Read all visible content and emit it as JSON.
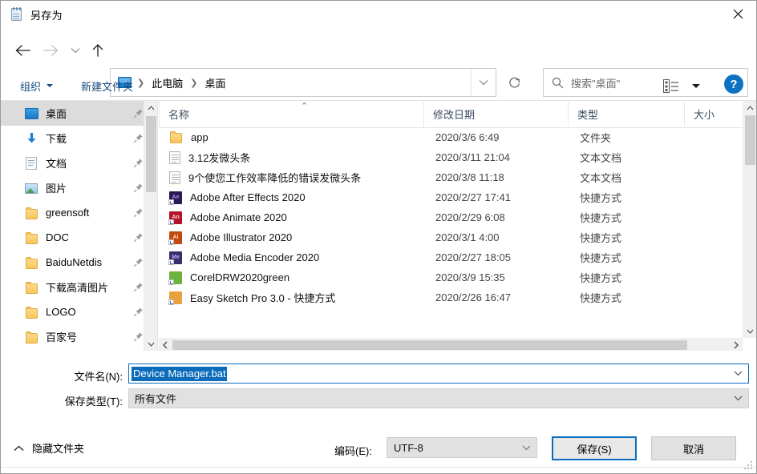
{
  "window": {
    "title": "另存为",
    "title_icon": "notepad-icon",
    "close_label": "✕"
  },
  "nav": {
    "back": "←",
    "forward": "→",
    "recent": "⌄",
    "up": "↑",
    "refresh": "↻",
    "breadcrumb": {
      "icon": "this-pc-icon",
      "items": [
        "此电脑",
        "桌面"
      ],
      "separator": "❯"
    },
    "dropdown": "⌄"
  },
  "search": {
    "placeholder": "搜索\"桌面\"",
    "icon": "search-icon"
  },
  "commandbar": {
    "organize": "组织",
    "new_folder": "新建文件夹",
    "view_icon": "list-view-icon",
    "view_caret": "▾",
    "help": "?"
  },
  "sidebar": {
    "items": [
      {
        "label": "桌面",
        "icon": "desktop-icon",
        "pinned": true,
        "selected": true
      },
      {
        "label": "下载",
        "icon": "download-icon",
        "pinned": true,
        "selected": false
      },
      {
        "label": "文档",
        "icon": "document-icon",
        "pinned": true,
        "selected": false
      },
      {
        "label": "图片",
        "icon": "picture-icon",
        "pinned": true,
        "selected": false
      },
      {
        "label": "greensoft",
        "icon": "folder-icon",
        "pinned": true,
        "selected": false
      },
      {
        "label": "DOC",
        "icon": "folder-icon",
        "pinned": true,
        "selected": false
      },
      {
        "label": "BaiduNetdis",
        "icon": "folder-icon",
        "pinned": true,
        "selected": false
      },
      {
        "label": "下载高清图片",
        "icon": "folder-icon",
        "pinned": true,
        "selected": false
      },
      {
        "label": "LOGO",
        "icon": "folder-icon",
        "pinned": true,
        "selected": false
      },
      {
        "label": "百家号",
        "icon": "folder-icon",
        "pinned": true,
        "selected": false
      }
    ],
    "scroll_up": "⌃",
    "scroll_down": "⌄"
  },
  "filelist": {
    "columns": [
      "名称",
      "修改日期",
      "类型",
      "大小"
    ],
    "sort_indicator": "⌃",
    "rows": [
      {
        "name": "app",
        "date": "2020/3/6 6:49",
        "type": "文件夹",
        "size": "",
        "icon": "folder-icon",
        "icon_kind": "folder"
      },
      {
        "name": "3.12发微头条",
        "date": "2020/3/11 21:04",
        "type": "文本文档",
        "size": "",
        "icon": "text-file-icon",
        "icon_kind": "text"
      },
      {
        "name": "9个使您工作效率降低的错误发微头条",
        "date": "2020/3/8 11:18",
        "type": "文本文档",
        "size": "",
        "icon": "text-file-icon",
        "icon_kind": "text"
      },
      {
        "name": "Adobe After Effects 2020",
        "date": "2020/2/27 17:41",
        "type": "快捷方式",
        "size": "",
        "icon": "after-effects-icon",
        "icon_kind": "app",
        "badge": "Ae",
        "color": "#2a1a52",
        "text_color": "#a193f4"
      },
      {
        "name": "Adobe Animate 2020",
        "date": "2020/2/29 6:08",
        "type": "快捷方式",
        "size": "",
        "icon": "animate-icon",
        "icon_kind": "app",
        "badge": "An",
        "color": "#b3142a",
        "text_color": "#ffd4d8"
      },
      {
        "name": "Adobe Illustrator 2020",
        "date": "2020/3/1 4:00",
        "type": "快捷方式",
        "size": "",
        "icon": "illustrator-icon",
        "icon_kind": "app",
        "badge": "Ai",
        "color": "#c24a10",
        "text_color": "#ffe0b2"
      },
      {
        "name": "Adobe Media Encoder 2020",
        "date": "2020/2/27 18:05",
        "type": "快捷方式",
        "size": "",
        "icon": "media-encoder-icon",
        "icon_kind": "app",
        "badge": "Me",
        "color": "#3b2e6e",
        "text_color": "#b9aef7"
      },
      {
        "name": "CorelDRW2020green",
        "date": "2020/3/9 15:35",
        "type": "快捷方式",
        "size": "",
        "icon": "coreldraw-icon",
        "icon_kind": "app",
        "badge": "",
        "color": "#6cb33f",
        "text_color": "#ffffff"
      },
      {
        "name": "Easy Sketch Pro 3.0 - 快捷方式",
        "date": "2020/2/26 16:47",
        "type": "快捷方式",
        "size": "",
        "icon": "easy-sketch-icon",
        "icon_kind": "app",
        "badge": "",
        "color": "#e8a13c",
        "text_color": "#ffffff"
      }
    ],
    "h_scroll_left": "❮",
    "h_scroll_right": "❯",
    "v_scroll_up": "⌃",
    "v_scroll_down": "⌄"
  },
  "form": {
    "filename_label": "文件名(N):",
    "filename_value": "Device Manager.bat",
    "savetype_label": "保存类型(T):",
    "savetype_value": "所有文件",
    "encoding_label": "编码(E):",
    "encoding_value": "UTF-8",
    "hide_folders": "隐藏文件夹",
    "hide_folders_caret": "⌃",
    "save_button": "保存(S)",
    "cancel_button": "取消",
    "combo_chevron": "⌄"
  },
  "colors": {
    "accent": "#0a6cbb",
    "selection": "#0a6cbb",
    "link": "#15497d",
    "help_blue": "#0d72c4"
  }
}
